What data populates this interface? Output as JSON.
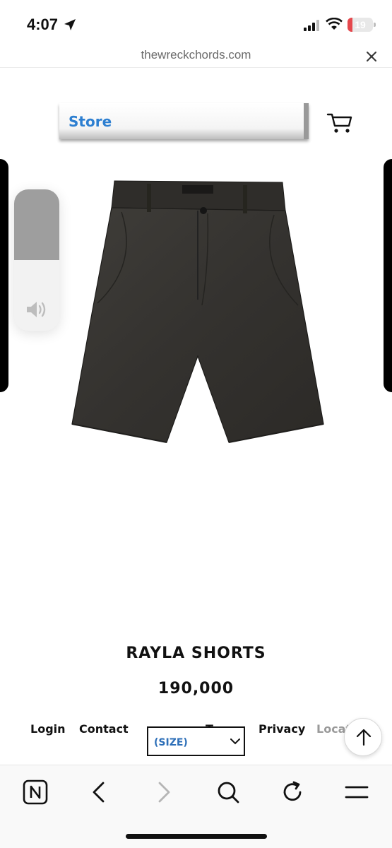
{
  "status_bar": {
    "time": "4:07",
    "battery": "19",
    "battery_color": "#e5484d",
    "icons": [
      "location-arrow-icon",
      "signal-icon",
      "wifi-icon",
      "battery-icon"
    ]
  },
  "browser": {
    "url": "thewreckchords.com",
    "close_icon": "close-icon"
  },
  "header": {
    "store_label": "Store",
    "store_color": "#2d7fd1",
    "cart_icon": "cart-icon"
  },
  "product": {
    "image": "shorts-image",
    "title": "RAYLA SHORTS",
    "price": "190,000"
  },
  "volume_hud": {
    "level": 0.5,
    "icon": "speaker-icon"
  },
  "footer": {
    "links": [
      "Login",
      "Contact",
      "Terms",
      "Privacy",
      "Locati"
    ],
    "size_select": "(SIZE)",
    "size_color": "#2d6fb8",
    "scroll_top_icon": "arrow-up-icon"
  },
  "toolbar": {
    "icons": [
      "n-logo-icon",
      "back-icon",
      "forward-icon",
      "search-icon",
      "reload-icon",
      "menu-icon"
    ]
  }
}
